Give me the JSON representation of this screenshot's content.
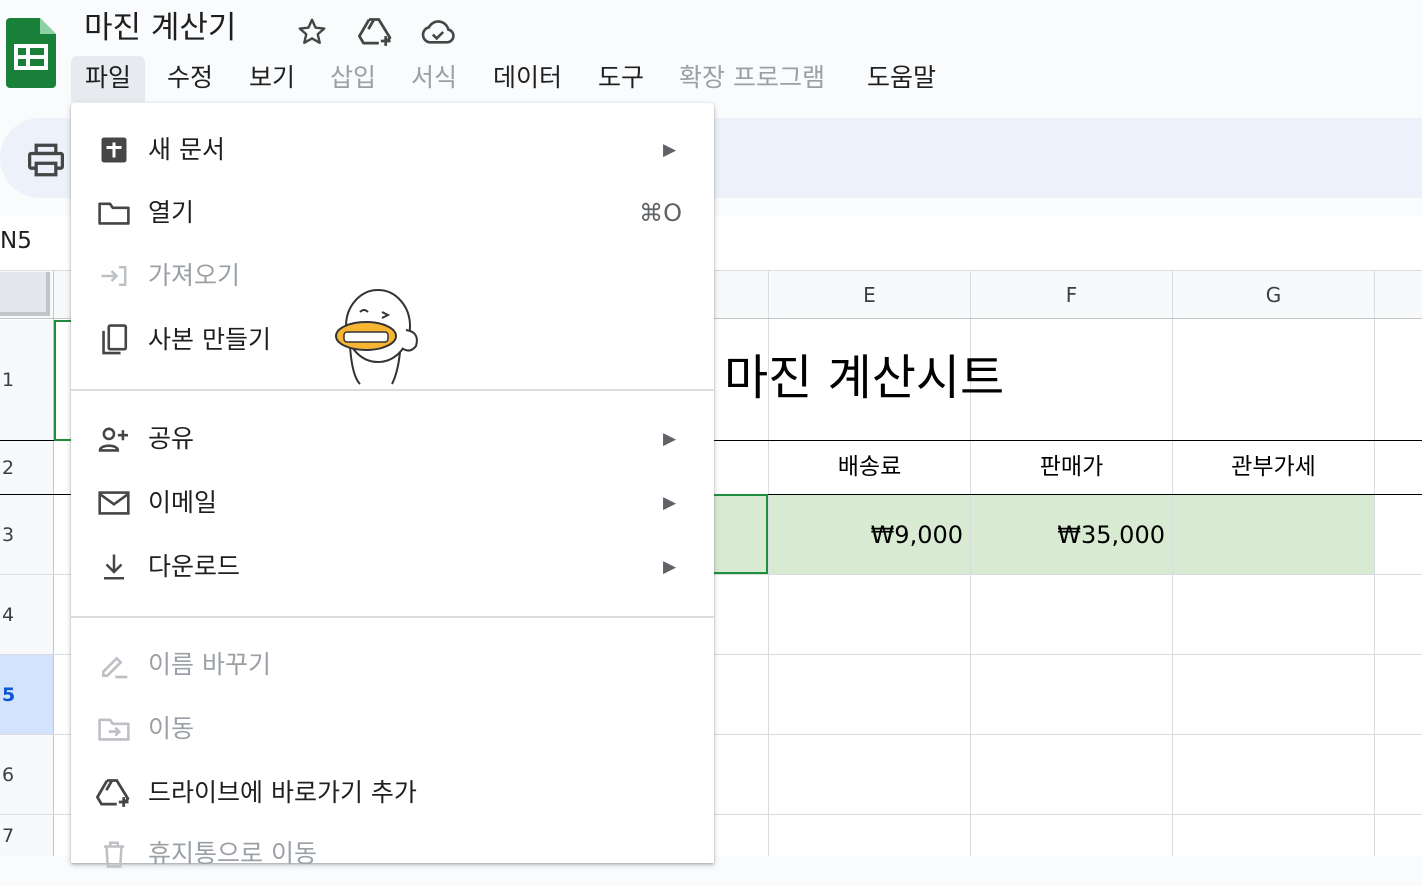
{
  "app": {
    "title": "마진 계산기"
  },
  "menu_bar": [
    {
      "label": "파일",
      "enabled": true,
      "active": true
    },
    {
      "label": "수정",
      "enabled": true
    },
    {
      "label": "보기",
      "enabled": true
    },
    {
      "label": "삽입",
      "enabled": false
    },
    {
      "label": "서식",
      "enabled": false
    },
    {
      "label": "데이터",
      "enabled": true
    },
    {
      "label": "도구",
      "enabled": true
    },
    {
      "label": "확장 프로그램",
      "enabled": false
    },
    {
      "label": "도움말",
      "enabled": true
    }
  ],
  "name_box": {
    "value": "N5"
  },
  "file_menu": {
    "items": [
      {
        "label": "새 문서",
        "icon": "new-document-icon",
        "submenu": true,
        "enabled": true
      },
      {
        "label": "열기",
        "icon": "folder-icon",
        "shortcut": "⌘O",
        "enabled": true
      },
      {
        "label": "가져오기",
        "icon": "import-icon",
        "enabled": false
      },
      {
        "label": "사본 만들기",
        "icon": "copy-icon",
        "enabled": true
      },
      {
        "label": "공유",
        "icon": "share-person-icon",
        "submenu": true,
        "enabled": true
      },
      {
        "label": "이메일",
        "icon": "email-icon",
        "submenu": true,
        "enabled": true
      },
      {
        "label": "다운로드",
        "icon": "download-icon",
        "submenu": true,
        "enabled": true
      },
      {
        "label": "이름 바꾸기",
        "icon": "rename-pencil-icon",
        "enabled": false
      },
      {
        "label": "이동",
        "icon": "move-folder-icon",
        "enabled": false
      },
      {
        "label": "드라이브에 바로가기 추가",
        "icon": "drive-add-icon",
        "enabled": true
      },
      {
        "label": "휴지통으로 이동",
        "icon": "trash-icon",
        "enabled": false
      }
    ],
    "submenu_arrow": "▶"
  },
  "sheet": {
    "columns": [
      "E",
      "F",
      "G"
    ],
    "rows": [
      "1",
      "2",
      "3",
      "4",
      "5",
      "6",
      "7"
    ],
    "selected_row": "5",
    "title": "마진 계산시트",
    "table_headers": {
      "E": "배송료",
      "F": "판매가",
      "G": "관부가세"
    },
    "row3_values": {
      "E": "₩9,000",
      "F": "₩35,000",
      "G": ""
    }
  },
  "colors": {
    "sheets_green": "#188038",
    "selection_green": "#1e8e3e",
    "row_band": "#d9ead3",
    "toolbar_bg": "#edf2fa",
    "selected_row_header": "#d3e3fd"
  }
}
